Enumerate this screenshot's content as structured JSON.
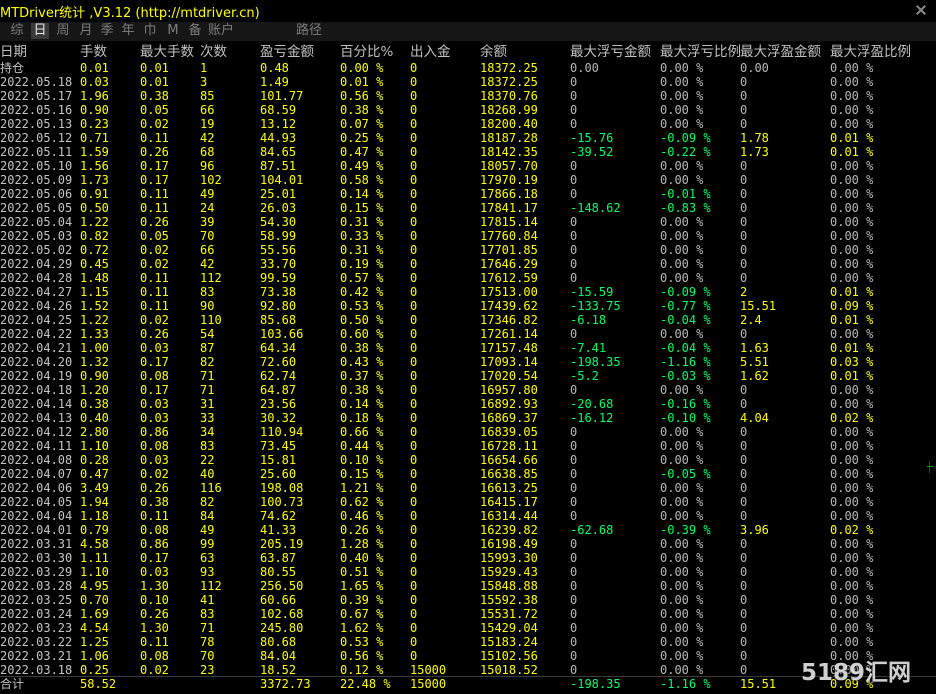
{
  "window": {
    "title": "MTDriver统计 ,V3.12 (http://mtdriver.cn)"
  },
  "tabs": [
    {
      "label": "综",
      "active": false
    },
    {
      "label": "日",
      "active": true
    },
    {
      "label": "周",
      "active": false
    },
    {
      "label": "月",
      "active": false
    },
    {
      "label": "季",
      "active": false
    },
    {
      "label": "年",
      "active": false
    },
    {
      "label": "巾",
      "active": false
    },
    {
      "label": "M",
      "active": false
    },
    {
      "label": "备",
      "active": false
    },
    {
      "label": "账户",
      "active": false
    },
    {
      "label": "路径",
      "active": false
    }
  ],
  "table": {
    "headers": [
      "日期",
      "手数",
      "最大手数",
      "次数",
      "盈亏金额",
      "百分比%",
      "出入金",
      "余额",
      "最大浮亏金额",
      "最大浮亏比例",
      "最大浮盈金额",
      "最大浮盈比例"
    ],
    "rows": [
      [
        "持仓",
        "0.01",
        "0.01",
        "1",
        "0.48",
        "0.00 %",
        "0",
        "18372.25",
        "0.00",
        "0.00 %",
        "0.00",
        "0.00 %"
      ],
      [
        "2022.05.18",
        "0.03",
        "0.01",
        "3",
        "1.49",
        "0.01 %",
        "0",
        "18372.25",
        "0",
        "0.00 %",
        "0",
        "0.00 %"
      ],
      [
        "2022.05.17",
        "1.96",
        "0.38",
        "85",
        "101.77",
        "0.56 %",
        "0",
        "18370.76",
        "0",
        "0.00 %",
        "0",
        "0.00 %"
      ],
      [
        "2022.05.16",
        "0.90",
        "0.05",
        "66",
        "68.59",
        "0.38 %",
        "0",
        "18268.99",
        "0",
        "0.00 %",
        "0",
        "0.00 %"
      ],
      [
        "2022.05.13",
        "0.23",
        "0.02",
        "19",
        "13.12",
        "0.07 %",
        "0",
        "18200.40",
        "0",
        "0.00 %",
        "0",
        "0.00 %"
      ],
      [
        "2022.05.12",
        "0.71",
        "0.11",
        "42",
        "44.93",
        "0.25 %",
        "0",
        "18187.28",
        "-15.76",
        "-0.09 %",
        "1.78",
        "0.01 %"
      ],
      [
        "2022.05.11",
        "1.59",
        "0.26",
        "68",
        "84.65",
        "0.47 %",
        "0",
        "18142.35",
        "-39.52",
        "-0.22 %",
        "1.73",
        "0.01 %"
      ],
      [
        "2022.05.10",
        "1.56",
        "0.17",
        "96",
        "87.51",
        "0.49 %",
        "0",
        "18057.70",
        "0",
        "0.00 %",
        "0",
        "0.00 %"
      ],
      [
        "2022.05.09",
        "1.73",
        "0.17",
        "102",
        "104.01",
        "0.58 %",
        "0",
        "17970.19",
        "0",
        "0.00 %",
        "0",
        "0.00 %"
      ],
      [
        "2022.05.06",
        "0.91",
        "0.11",
        "49",
        "25.01",
        "0.14 %",
        "0",
        "17866.18",
        "0",
        "-0.01 %",
        "0",
        "0.00 %"
      ],
      [
        "2022.05.05",
        "0.50",
        "0.11",
        "24",
        "26.03",
        "0.15 %",
        "0",
        "17841.17",
        "-148.62",
        "-0.83 %",
        "0",
        "0.00 %"
      ],
      [
        "2022.05.04",
        "1.22",
        "0.26",
        "39",
        "54.30",
        "0.31 %",
        "0",
        "17815.14",
        "0",
        "0.00 %",
        "0",
        "0.00 %"
      ],
      [
        "2022.05.03",
        "0.82",
        "0.05",
        "70",
        "58.99",
        "0.33 %",
        "0",
        "17760.84",
        "0",
        "0.00 %",
        "0",
        "0.00 %"
      ],
      [
        "2022.05.02",
        "0.72",
        "0.02",
        "66",
        "55.56",
        "0.31 %",
        "0",
        "17701.85",
        "0",
        "0.00 %",
        "0",
        "0.00 %"
      ],
      [
        "2022.04.29",
        "0.45",
        "0.02",
        "42",
        "33.70",
        "0.19 %",
        "0",
        "17646.29",
        "0",
        "0.00 %",
        "0",
        "0.00 %"
      ],
      [
        "2022.04.28",
        "1.48",
        "0.11",
        "112",
        "99.59",
        "0.57 %",
        "0",
        "17612.59",
        "0",
        "0.00 %",
        "0",
        "0.00 %"
      ],
      [
        "2022.04.27",
        "1.15",
        "0.11",
        "83",
        "73.38",
        "0.42 %",
        "0",
        "17513.00",
        "-15.59",
        "-0.09 %",
        "2",
        "0.01 %"
      ],
      [
        "2022.04.26",
        "1.52",
        "0.11",
        "90",
        "92.80",
        "0.53 %",
        "0",
        "17439.62",
        "-133.75",
        "-0.77 %",
        "15.51",
        "0.09 %"
      ],
      [
        "2022.04.25",
        "1.22",
        "0.02",
        "110",
        "85.68",
        "0.50 %",
        "0",
        "17346.82",
        "-6.18",
        "-0.04 %",
        "2.4",
        "0.01 %"
      ],
      [
        "2022.04.22",
        "1.33",
        "0.26",
        "54",
        "103.66",
        "0.60 %",
        "0",
        "17261.14",
        "0",
        "0.00 %",
        "0",
        "0.00 %"
      ],
      [
        "2022.04.21",
        "1.00",
        "0.03",
        "87",
        "64.34",
        "0.38 %",
        "0",
        "17157.48",
        "-7.41",
        "-0.04 %",
        "1.63",
        "0.01 %"
      ],
      [
        "2022.04.20",
        "1.32",
        "0.17",
        "82",
        "72.60",
        "0.43 %",
        "0",
        "17093.14",
        "-198.35",
        "-1.16 %",
        "5.51",
        "0.03 %"
      ],
      [
        "2022.04.19",
        "0.90",
        "0.08",
        "71",
        "62.74",
        "0.37 %",
        "0",
        "17020.54",
        "-5.2",
        "-0.03 %",
        "1.62",
        "0.01 %"
      ],
      [
        "2022.04.18",
        "1.20",
        "0.17",
        "71",
        "64.87",
        "0.38 %",
        "0",
        "16957.80",
        "0",
        "0.00 %",
        "0",
        "0.00 %"
      ],
      [
        "2022.04.14",
        "0.38",
        "0.03",
        "31",
        "23.56",
        "0.14 %",
        "0",
        "16892.93",
        "-20.68",
        "-0.16 %",
        "0",
        "0.00 %"
      ],
      [
        "2022.04.13",
        "0.40",
        "0.03",
        "33",
        "30.32",
        "0.18 %",
        "0",
        "16869.37",
        "-16.12",
        "-0.10 %",
        "4.04",
        "0.02 %"
      ],
      [
        "2022.04.12",
        "2.80",
        "0.86",
        "34",
        "110.94",
        "0.66 %",
        "0",
        "16839.05",
        "0",
        "0.00 %",
        "0",
        "0.00 %"
      ],
      [
        "2022.04.11",
        "1.10",
        "0.08",
        "83",
        "73.45",
        "0.44 %",
        "0",
        "16728.11",
        "0",
        "0.00 %",
        "0",
        "0.00 %"
      ],
      [
        "2022.04.08",
        "0.28",
        "0.03",
        "22",
        "15.81",
        "0.10 %",
        "0",
        "16654.66",
        "0",
        "0.00 %",
        "0",
        "0.00 %"
      ],
      [
        "2022.04.07",
        "0.47",
        "0.02",
        "40",
        "25.60",
        "0.15 %",
        "0",
        "16638.85",
        "0",
        "-0.05 %",
        "0",
        "0.00 %"
      ],
      [
        "2022.04.06",
        "3.49",
        "0.26",
        "116",
        "198.08",
        "1.21 %",
        "0",
        "16613.25",
        "0",
        "0.00 %",
        "0",
        "0.00 %"
      ],
      [
        "2022.04.05",
        "1.94",
        "0.38",
        "82",
        "100.73",
        "0.62 %",
        "0",
        "16415.17",
        "0",
        "0.00 %",
        "0",
        "0.00 %"
      ],
      [
        "2022.04.04",
        "1.18",
        "0.11",
        "84",
        "74.62",
        "0.46 %",
        "0",
        "16314.44",
        "0",
        "0.00 %",
        "0",
        "0.00 %"
      ],
      [
        "2022.04.01",
        "0.79",
        "0.08",
        "49",
        "41.33",
        "0.26 %",
        "0",
        "16239.82",
        "-62.68",
        "-0.39 %",
        "3.96",
        "0.02 %"
      ],
      [
        "2022.03.31",
        "4.58",
        "0.86",
        "99",
        "205.19",
        "1.28 %",
        "0",
        "16198.49",
        "0",
        "0.00 %",
        "0",
        "0.00 %"
      ],
      [
        "2022.03.30",
        "1.11",
        "0.17",
        "63",
        "63.87",
        "0.40 %",
        "0",
        "15993.30",
        "0",
        "0.00 %",
        "0",
        "0.00 %"
      ],
      [
        "2022.03.29",
        "1.10",
        "0.03",
        "93",
        "80.55",
        "0.51 %",
        "0",
        "15929.43",
        "0",
        "0.00 %",
        "0",
        "0.00 %"
      ],
      [
        "2022.03.28",
        "4.95",
        "1.30",
        "112",
        "256.50",
        "1.65 %",
        "0",
        "15848.88",
        "0",
        "0.00 %",
        "0",
        "0.00 %"
      ],
      [
        "2022.03.25",
        "0.70",
        "0.10",
        "41",
        "60.66",
        "0.39 %",
        "0",
        "15592.38",
        "0",
        "0.00 %",
        "0",
        "0.00 %"
      ],
      [
        "2022.03.24",
        "1.69",
        "0.26",
        "83",
        "102.68",
        "0.67 %",
        "0",
        "15531.72",
        "0",
        "0.00 %",
        "0",
        "0.00 %"
      ],
      [
        "2022.03.23",
        "4.54",
        "1.30",
        "71",
        "245.80",
        "1.62 %",
        "0",
        "15429.04",
        "0",
        "0.00 %",
        "0",
        "0.00 %"
      ],
      [
        "2022.03.22",
        "1.25",
        "0.11",
        "78",
        "80.68",
        "0.53 %",
        "0",
        "15183.24",
        "0",
        "0.00 %",
        "0",
        "0.00 %"
      ],
      [
        "2022.03.21",
        "1.06",
        "0.08",
        "70",
        "84.04",
        "0.56 %",
        "0",
        "15102.56",
        "0",
        "0.00 %",
        "0",
        "0.00 %"
      ],
      [
        "2022.03.18",
        "0.25",
        "0.02",
        "23",
        "18.52",
        "0.12 %",
        "15000",
        "15018.52",
        "0",
        "0.00 %",
        "0",
        "0.00 %"
      ]
    ],
    "total": [
      "合计",
      "58.52",
      "",
      "",
      "3372.73",
      "22.48 %",
      "15000",
      "",
      "-198.35",
      "-1.16 %",
      "15.51",
      "0.09 %"
    ]
  },
  "watermark": "5189汇网",
  "colors": {
    "background": "#000000",
    "positive": "#ffff00",
    "negative": "#00ff66",
    "neutral": "#b8b8b8",
    "header": "#c0c0c0",
    "title": "#ffff00"
  }
}
